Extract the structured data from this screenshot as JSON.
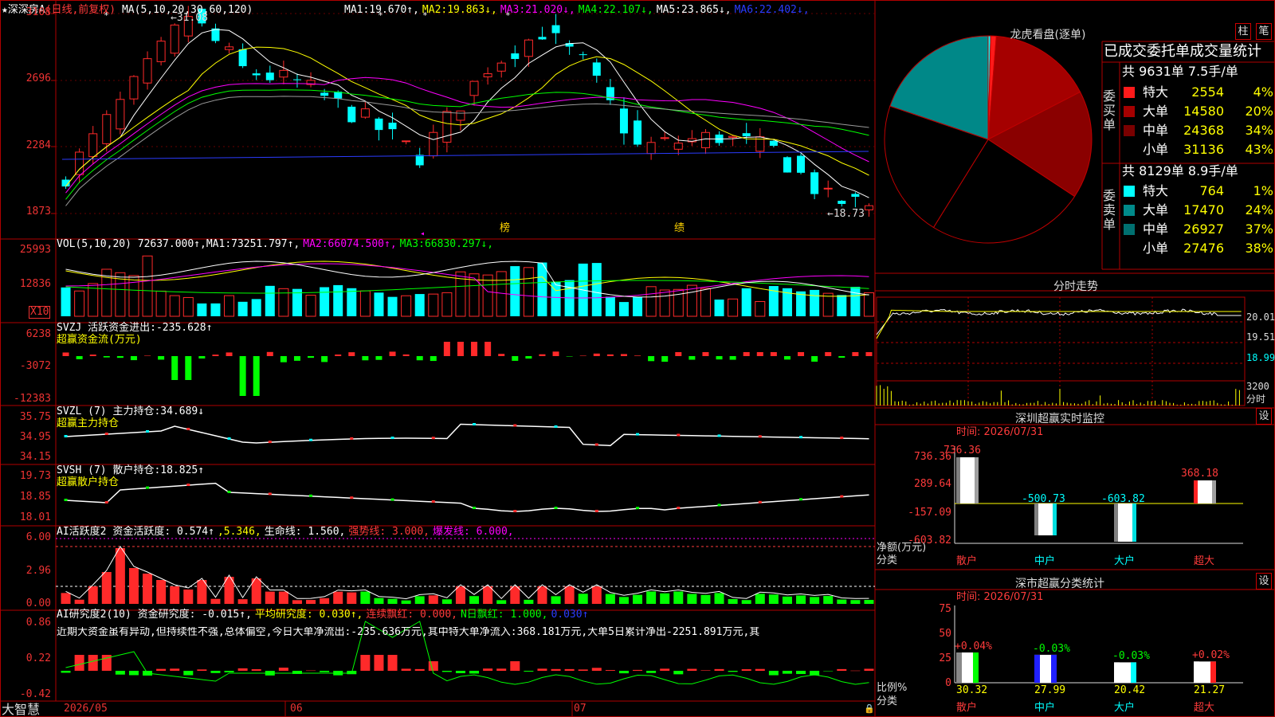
{
  "colors": {
    "up": "#ff2a2a",
    "down": "#00ffff",
    "bg": "#000000",
    "grid": "#b30000",
    "ma1": "#ffffff",
    "ma2": "#ffff00",
    "ma3": "#ff00ff",
    "ma4": "#00ff00",
    "ma5": "#9a9a9a",
    "ma6": "#2b3cff"
  },
  "kline": {
    "stock": "★深深房A",
    "mode": "(日线,前复权)",
    "ma_label": "MA(5,10,20,30,60,120)",
    "ma": [
      {
        "name": "MA1:",
        "value": "19.670↑",
        "color": "#ffffff"
      },
      {
        "name": "MA2:",
        "value": "19.863↓",
        "color": "#ffff00"
      },
      {
        "name": "MA3:",
        "value": "21.020↓",
        "color": "#ff00ff"
      },
      {
        "name": "MA4:",
        "value": "22.107↓",
        "color": "#00ff00"
      },
      {
        "name": "MA5:",
        "value": "23.865↓",
        "color": "#ffffff"
      },
      {
        "name": "MA6:",
        "value": "22.402↓",
        "color": "#2b3cff"
      }
    ],
    "y_ticks": [
      "3108",
      "2696",
      "2284",
      "1873"
    ],
    "high_label": "31.08",
    "low_label": "18.73",
    "marks": [
      {
        "label": "榜"
      },
      {
        "label": "绩"
      }
    ],
    "axis_marker": "◂"
  },
  "vol": {
    "label": "VOL(5,10,20)",
    "value": "72637.000↑",
    "ma": [
      {
        "name": "MA1:",
        "value": "73251.797↑",
        "color": "#ffffff"
      },
      {
        "name": "MA2:",
        "value": "66074.500↑",
        "color": "#ff00ff"
      },
      {
        "name": "MA3:",
        "value": "66830.297↓",
        "color": "#00ff00"
      }
    ],
    "y_ticks": [
      "25993",
      "12836"
    ],
    "unit": "X10"
  },
  "svzj": {
    "label": "SVZJ",
    "name": "活跃资金进出:",
    "value": "-235.628↑",
    "sub": "超赢资金流(万元)",
    "y_ticks": [
      "6238",
      "-3072",
      "-12383"
    ]
  },
  "svzl": {
    "label": "SVZL (7)",
    "name": "主力持仓:",
    "value": "34.689↓",
    "sub": "超赢主力持仓",
    "y_ticks": [
      "35.75",
      "34.95",
      "34.15"
    ]
  },
  "svsh": {
    "label": "SVSH (7)",
    "name": "散户持仓:",
    "value": "18.825↑",
    "sub": "超赢散户持仓",
    "y_ticks": [
      "19.73",
      "18.85",
      "18.01"
    ]
  },
  "ai1": {
    "label": "AI活跃度2",
    "items": [
      {
        "t": "资金活跃度: 0.574↑",
        "c": "#ffffff"
      },
      {
        "t": ",5.346,",
        "c": "#ffff00"
      },
      {
        "t": "生命线: 1.560,",
        "c": "#ffffff"
      },
      {
        "t": "强势线: 3.000,",
        "c": "#ff3b3b"
      },
      {
        "t": "爆发线: 6.000,",
        "c": "#ff00ff"
      }
    ],
    "y_ticks": [
      "6.00",
      "2.96",
      "0.00"
    ]
  },
  "ai2": {
    "label": "AI研究度2(10)",
    "items": [
      {
        "t": "资金研究度: -0.015↑,",
        "c": "#ffffff"
      },
      {
        "t": "平均研究度: 0.030↑,",
        "c": "#ffff00"
      },
      {
        "t": "连续飘红: 0.000,",
        "c": "#ff3b3b"
      },
      {
        "t": "N日飘红: 1.000,",
        "c": "#00ff00"
      },
      {
        "t": "0.030↑",
        "c": "#2b3cff"
      }
    ],
    "comment": "近期大资金虽有异动,但持续性不强,总体偏空,今日大单净流出:-235.636万元,其中特大单净流入:368.181万元,大单5日累计净出-2251.891万元,其",
    "y_ticks": [
      "0.86",
      "0.22",
      "-0.42"
    ]
  },
  "date_axis": {
    "labels": [
      "2026/05",
      "06",
      "07"
    ]
  },
  "logo": "大智慧",
  "dragon": {
    "title": "龙虎看盘(逐单)",
    "btn_zhu": "柱",
    "btn_bi": "笔",
    "subtitle": "已成交委托单成交量统计",
    "buy": {
      "side": "委买单",
      "summary": "共 9631单 7.5手/单",
      "rows": [
        {
          "label": "特大",
          "qty": "2554",
          "pct": "4%",
          "color": "#ff1a1a"
        },
        {
          "label": "大单",
          "qty": "14580",
          "pct": "20%",
          "color": "#a50000"
        },
        {
          "label": "中单",
          "qty": "24368",
          "pct": "34%",
          "color": "#7a0000"
        },
        {
          "label": "小单",
          "qty": "31136",
          "pct": "43%",
          "color": "#000000"
        }
      ]
    },
    "sell": {
      "side": "委卖单",
      "summary": "共 8129单 8.9手/单",
      "rows": [
        {
          "label": "特大",
          "qty": "764",
          "pct": "1%",
          "color": "#00ffff"
        },
        {
          "label": "大单",
          "qty": "17470",
          "pct": "24%",
          "color": "#008a8a"
        },
        {
          "label": "中单",
          "qty": "26927",
          "pct": "37%",
          "color": "#007070"
        },
        {
          "label": "小单",
          "qty": "27476",
          "pct": "38%",
          "color": "#000000"
        }
      ]
    },
    "pie": [
      0.5,
      2.1,
      7.6,
      13.2,
      17,
      0.1,
      9,
      13,
      20.5,
      17
    ]
  },
  "minute": {
    "title": "分时走势",
    "y_ticks": [
      "20.01",
      "19.51",
      "18.99"
    ],
    "vol_tick": "3200",
    "vol_unit": "分时"
  },
  "monitor": {
    "title": "深圳超赢实时监控",
    "btn": "设",
    "date": "时间: 2026/07/31",
    "y_ticks": [
      "736.36",
      "289.64",
      "-157.09",
      "-603.82"
    ],
    "ylabel": "净额(万元)",
    "xlabel": "分类",
    "chart_data": {
      "type": "bar",
      "categories": [
        "散户",
        "中户",
        "大户",
        "超大"
      ],
      "values": [
        736.36,
        -500.73,
        -603.82,
        368.18
      ],
      "ylim": [
        -603.82,
        736.36
      ]
    }
  },
  "classify": {
    "title": "深市超赢分类统计",
    "btn": "设",
    "date": "时间: 2026/07/31",
    "y_ticks": [
      "75",
      "50",
      "25",
      "0"
    ],
    "ylabel": "比例%",
    "xlabel": "分类",
    "chart_data": {
      "type": "bar",
      "categories": [
        "散户",
        "中户",
        "大户",
        "超大"
      ],
      "values": [
        30.32,
        27.99,
        20.42,
        21.27
      ],
      "changes": [
        "+0.04%",
        "-0.03%",
        "-0.03%",
        "+0.02%"
      ],
      "ylim": [
        0,
        75
      ]
    }
  }
}
